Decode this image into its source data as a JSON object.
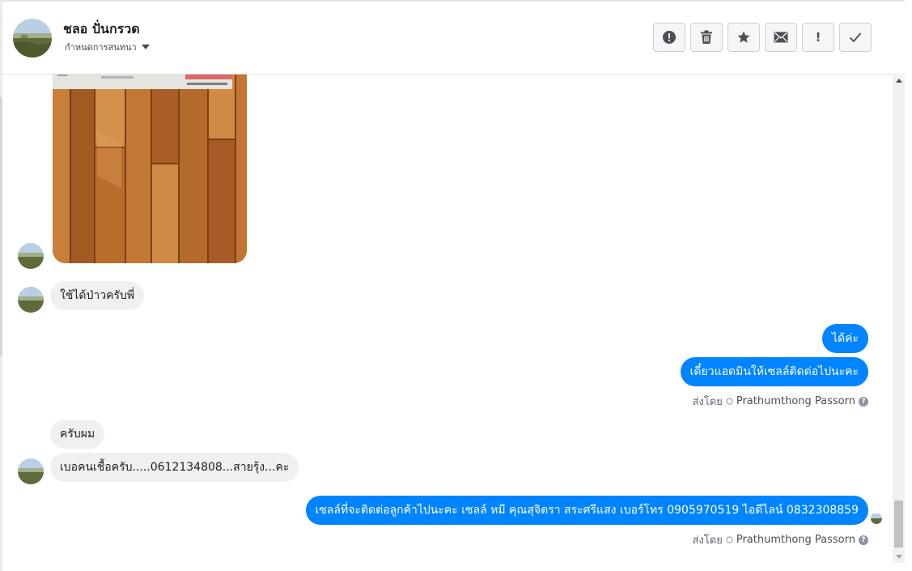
{
  "header": {
    "contact_name": "ชลอ ปั่นกรวด",
    "assign_label": "กำหนดการสนทนา",
    "actions": [
      {
        "id": "report",
        "icon": "alert-circle-icon"
      },
      {
        "id": "delete",
        "icon": "trash-icon"
      },
      {
        "id": "star",
        "icon": "star-icon"
      },
      {
        "id": "mark-unread",
        "icon": "envelope-icon"
      },
      {
        "id": "important",
        "icon": "exclamation-icon",
        "label": "!"
      },
      {
        "id": "done",
        "icon": "checkmark-icon"
      }
    ]
  },
  "messages": {
    "m1": "ใช้ได้ป่าวครับพี่",
    "m2": "ได้ค่ะ",
    "m3": "เดี๋ยวแอดมินให้เซลล์ติดต่อไปนะคะ",
    "sent_by_label": "ส่งโดย",
    "sender_name": "Prathumthong Passorn",
    "m4": "ครับผม",
    "m5": "เบอคนเชื้อครับ.....0612134808...สายรุ้ง...คะ",
    "m6": "เซลล์ที่จะติดต่อลูกค้าไปนะคะ เซลล์ หมี คุณสุจิตรา สระศรีแสง เบอร์โทร 0905970519 ไอดีไลน์ 0832308859"
  },
  "colors": {
    "outgoing_bubble": "#0084ff",
    "incoming_bubble": "#f1f0f0",
    "header_border": "#dddfe2"
  }
}
